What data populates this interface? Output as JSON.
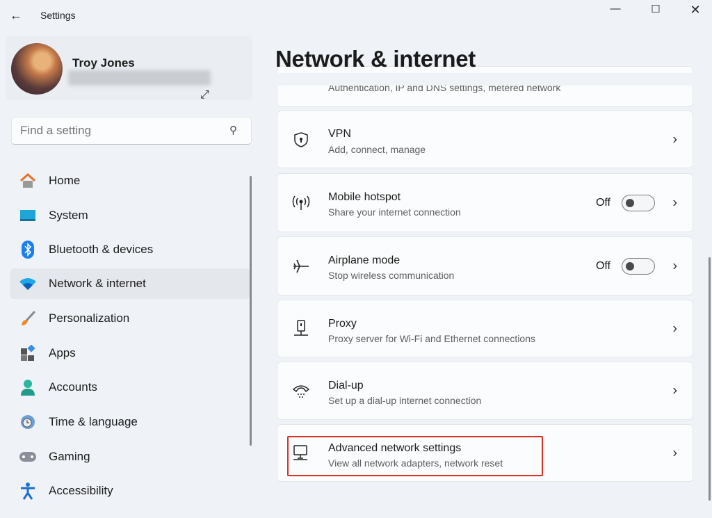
{
  "window": {
    "title": "Settings",
    "back_icon": "arrow-left-icon"
  },
  "profile": {
    "name": "Troy Jones"
  },
  "search": {
    "placeholder": "Find a setting"
  },
  "sidebar": {
    "items": [
      {
        "label": "Home",
        "icon": "home-icon"
      },
      {
        "label": "System",
        "icon": "system-icon"
      },
      {
        "label": "Bluetooth & devices",
        "icon": "bluetooth-icon"
      },
      {
        "label": "Network & internet",
        "icon": "wifi-icon",
        "active": true
      },
      {
        "label": "Personalization",
        "icon": "brush-icon"
      },
      {
        "label": "Apps",
        "icon": "apps-icon"
      },
      {
        "label": "Accounts",
        "icon": "person-icon"
      },
      {
        "label": "Time & language",
        "icon": "clock-globe-icon"
      },
      {
        "label": "Gaming",
        "icon": "gamepad-icon"
      },
      {
        "label": "Accessibility",
        "icon": "accessibility-icon"
      }
    ]
  },
  "main": {
    "title": "Network & internet",
    "partial_subtitle": "Authentication, IP and DNS settings, metered network",
    "cards": [
      {
        "title": "VPN",
        "subtitle": "Add, connect, manage"
      },
      {
        "title": "Mobile hotspot",
        "subtitle": "Share your internet connection",
        "toggle": "Off",
        "toggle_on": false
      },
      {
        "title": "Airplane mode",
        "subtitle": "Stop wireless communication",
        "toggle": "Off",
        "toggle_on": false
      },
      {
        "title": "Proxy",
        "subtitle": "Proxy server for Wi-Fi and Ethernet connections"
      },
      {
        "title": "Dial-up",
        "subtitle": "Set up a dial-up internet connection"
      },
      {
        "title": "Advanced network settings",
        "subtitle": "View all network adapters, network reset",
        "highlighted": true
      }
    ]
  },
  "colors": {
    "accent": "#3c4aa0",
    "highlight": "#d9302c",
    "background": "#eff3f8"
  }
}
